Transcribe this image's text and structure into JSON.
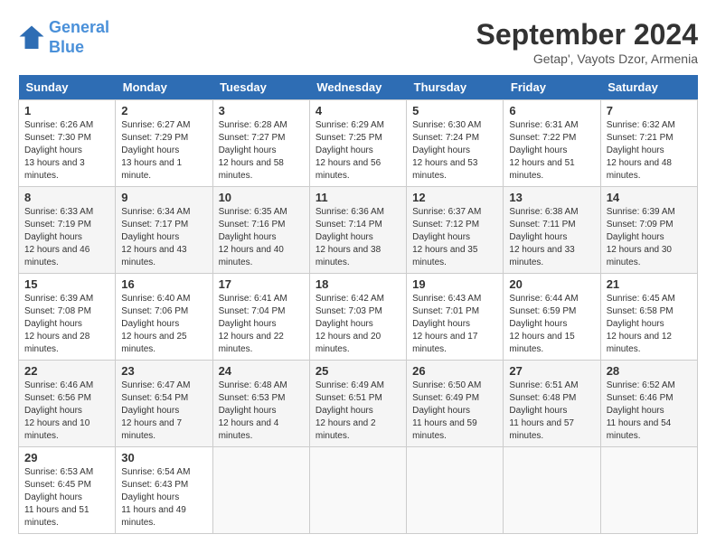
{
  "header": {
    "logo_line1": "General",
    "logo_line2": "Blue",
    "month": "September 2024",
    "location": "Getap', Vayots Dzor, Armenia"
  },
  "days_of_week": [
    "Sunday",
    "Monday",
    "Tuesday",
    "Wednesday",
    "Thursday",
    "Friday",
    "Saturday"
  ],
  "weeks": [
    [
      {
        "day": "1",
        "sunrise": "6:26 AM",
        "sunset": "7:30 PM",
        "daylight": "13 hours and 3 minutes."
      },
      {
        "day": "2",
        "sunrise": "6:27 AM",
        "sunset": "7:29 PM",
        "daylight": "13 hours and 1 minute."
      },
      {
        "day": "3",
        "sunrise": "6:28 AM",
        "sunset": "7:27 PM",
        "daylight": "12 hours and 58 minutes."
      },
      {
        "day": "4",
        "sunrise": "6:29 AM",
        "sunset": "7:25 PM",
        "daylight": "12 hours and 56 minutes."
      },
      {
        "day": "5",
        "sunrise": "6:30 AM",
        "sunset": "7:24 PM",
        "daylight": "12 hours and 53 minutes."
      },
      {
        "day": "6",
        "sunrise": "6:31 AM",
        "sunset": "7:22 PM",
        "daylight": "12 hours and 51 minutes."
      },
      {
        "day": "7",
        "sunrise": "6:32 AM",
        "sunset": "7:21 PM",
        "daylight": "12 hours and 48 minutes."
      }
    ],
    [
      {
        "day": "8",
        "sunrise": "6:33 AM",
        "sunset": "7:19 PM",
        "daylight": "12 hours and 46 minutes."
      },
      {
        "day": "9",
        "sunrise": "6:34 AM",
        "sunset": "7:17 PM",
        "daylight": "12 hours and 43 minutes."
      },
      {
        "day": "10",
        "sunrise": "6:35 AM",
        "sunset": "7:16 PM",
        "daylight": "12 hours and 40 minutes."
      },
      {
        "day": "11",
        "sunrise": "6:36 AM",
        "sunset": "7:14 PM",
        "daylight": "12 hours and 38 minutes."
      },
      {
        "day": "12",
        "sunrise": "6:37 AM",
        "sunset": "7:12 PM",
        "daylight": "12 hours and 35 minutes."
      },
      {
        "day": "13",
        "sunrise": "6:38 AM",
        "sunset": "7:11 PM",
        "daylight": "12 hours and 33 minutes."
      },
      {
        "day": "14",
        "sunrise": "6:39 AM",
        "sunset": "7:09 PM",
        "daylight": "12 hours and 30 minutes."
      }
    ],
    [
      {
        "day": "15",
        "sunrise": "6:39 AM",
        "sunset": "7:08 PM",
        "daylight": "12 hours and 28 minutes."
      },
      {
        "day": "16",
        "sunrise": "6:40 AM",
        "sunset": "7:06 PM",
        "daylight": "12 hours and 25 minutes."
      },
      {
        "day": "17",
        "sunrise": "6:41 AM",
        "sunset": "7:04 PM",
        "daylight": "12 hours and 22 minutes."
      },
      {
        "day": "18",
        "sunrise": "6:42 AM",
        "sunset": "7:03 PM",
        "daylight": "12 hours and 20 minutes."
      },
      {
        "day": "19",
        "sunrise": "6:43 AM",
        "sunset": "7:01 PM",
        "daylight": "12 hours and 17 minutes."
      },
      {
        "day": "20",
        "sunrise": "6:44 AM",
        "sunset": "6:59 PM",
        "daylight": "12 hours and 15 minutes."
      },
      {
        "day": "21",
        "sunrise": "6:45 AM",
        "sunset": "6:58 PM",
        "daylight": "12 hours and 12 minutes."
      }
    ],
    [
      {
        "day": "22",
        "sunrise": "6:46 AM",
        "sunset": "6:56 PM",
        "daylight": "12 hours and 10 minutes."
      },
      {
        "day": "23",
        "sunrise": "6:47 AM",
        "sunset": "6:54 PM",
        "daylight": "12 hours and 7 minutes."
      },
      {
        "day": "24",
        "sunrise": "6:48 AM",
        "sunset": "6:53 PM",
        "daylight": "12 hours and 4 minutes."
      },
      {
        "day": "25",
        "sunrise": "6:49 AM",
        "sunset": "6:51 PM",
        "daylight": "12 hours and 2 minutes."
      },
      {
        "day": "26",
        "sunrise": "6:50 AM",
        "sunset": "6:49 PM",
        "daylight": "11 hours and 59 minutes."
      },
      {
        "day": "27",
        "sunrise": "6:51 AM",
        "sunset": "6:48 PM",
        "daylight": "11 hours and 57 minutes."
      },
      {
        "day": "28",
        "sunrise": "6:52 AM",
        "sunset": "6:46 PM",
        "daylight": "11 hours and 54 minutes."
      }
    ],
    [
      {
        "day": "29",
        "sunrise": "6:53 AM",
        "sunset": "6:45 PM",
        "daylight": "11 hours and 51 minutes."
      },
      {
        "day": "30",
        "sunrise": "6:54 AM",
        "sunset": "6:43 PM",
        "daylight": "11 hours and 49 minutes."
      },
      {
        "day": "",
        "sunrise": "",
        "sunset": "",
        "daylight": ""
      },
      {
        "day": "",
        "sunrise": "",
        "sunset": "",
        "daylight": ""
      },
      {
        "day": "",
        "sunrise": "",
        "sunset": "",
        "daylight": ""
      },
      {
        "day": "",
        "sunrise": "",
        "sunset": "",
        "daylight": ""
      },
      {
        "day": "",
        "sunrise": "",
        "sunset": "",
        "daylight": ""
      }
    ]
  ]
}
